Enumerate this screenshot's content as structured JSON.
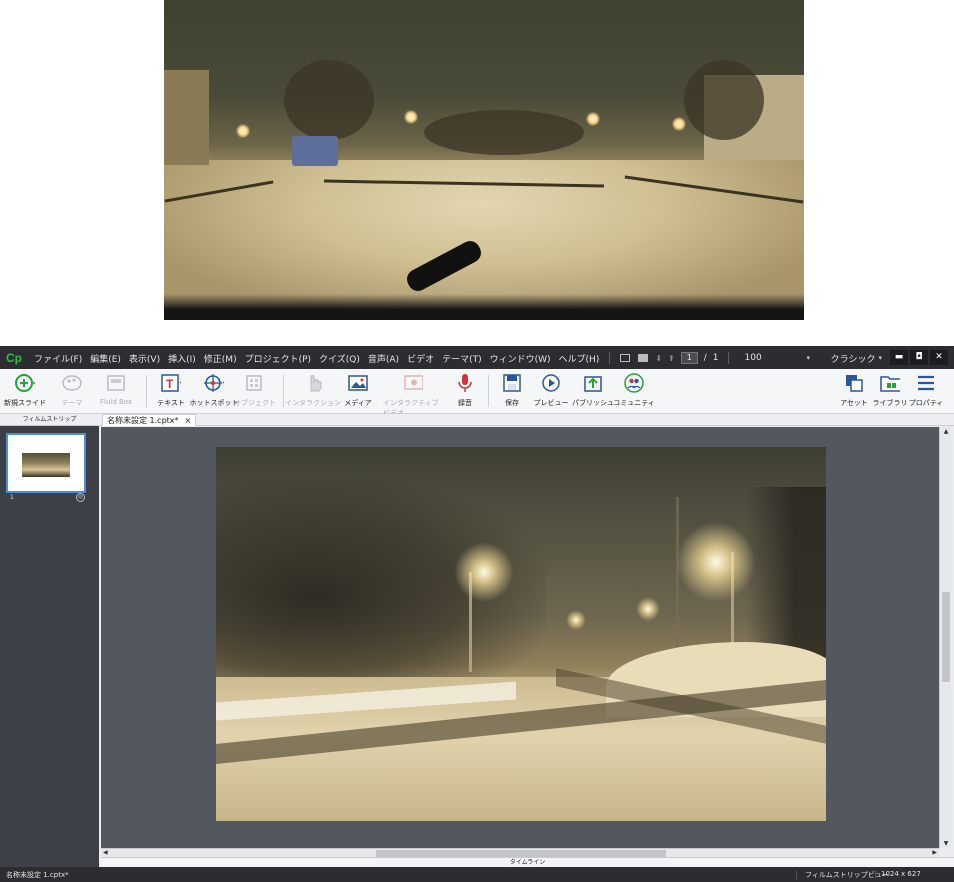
{
  "menubar": {
    "logo": "Cp",
    "items": [
      "ファイル(F)",
      "編集(E)",
      "表示(V)",
      "挿入(I)",
      "修正(M)",
      "プロジェクト(P)",
      "クイズ(Q)",
      "音声(A)",
      "ビデオ",
      "テーマ(T)",
      "ウィンドウ(W)",
      "ヘルプ(H)"
    ],
    "page_current": "1",
    "page_sep": "/",
    "page_total": "1",
    "zoom": "100",
    "workspace": "クラシック",
    "win_minimize": "▬",
    "win_restore": "◘",
    "win_close": "✕"
  },
  "toolbar": {
    "slides": "新規スライド",
    "themes": "テーマ",
    "fluidbox": "Fluid Box",
    "text": "テキスト",
    "hotspot": "ホットスポット",
    "objects": "オブジェクト",
    "interactions": "インタラクション",
    "media": "メディア",
    "interactive_video": "インタラクティブビデオ",
    "record": "録音",
    "save": "保存",
    "preview": "プレビュー",
    "publish": "パブリッシュ",
    "community": "コミュニティ",
    "assets": "アセット",
    "library": "ライブラリ",
    "properties": "プロパティ"
  },
  "filmstrip": {
    "header": "フィルムストリップ",
    "slide_number": "1",
    "badge": "◎"
  },
  "tabs": {
    "doc": "名称未設定 1.cptx*",
    "close": "×"
  },
  "timeline": {
    "label": "タイムライン"
  },
  "status": {
    "filename": "名称未設定 1.cptx*",
    "view": "フィルムストリップビュー",
    "size": "1024 x 627"
  },
  "colors": {
    "menubar_bg": "#2b2d31",
    "stage_bg": "#525760",
    "filmstrip_bg": "#3d4046",
    "accent_blue": "#4a90d9",
    "logo_green": "#2fbf4a"
  }
}
